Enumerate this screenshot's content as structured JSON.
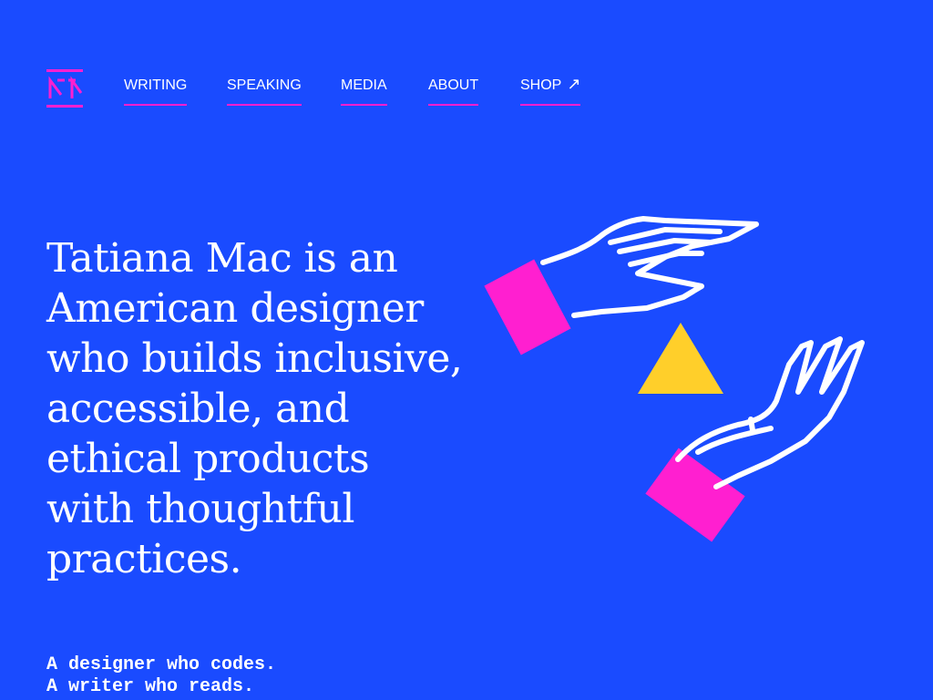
{
  "nav": {
    "items": [
      {
        "label": "WRITING"
      },
      {
        "label": "SPEAKING"
      },
      {
        "label": "MEDIA"
      },
      {
        "label": "ABOUT"
      },
      {
        "label": "SHOP"
      }
    ]
  },
  "hero": {
    "headline": "Tatiana Mac is an American designer who builds inclusive, accessible, and ethical products with thoughtful practices.",
    "tagline_lines": [
      "A designer who codes.",
      "A writer who reads."
    ]
  },
  "icons": {
    "logo": "tm-logo-icon",
    "shop_external": "external-arrow-icon",
    "illustration": "hands-triangle-illustration"
  },
  "colors": {
    "background": "#1a4bff",
    "accent_pink": "#ff1fd0",
    "accent_yellow": "#ffcf2a",
    "text": "#ffffff"
  }
}
